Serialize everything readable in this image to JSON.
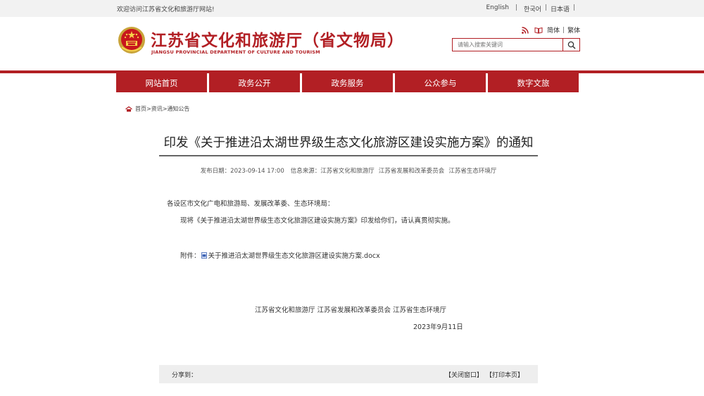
{
  "topbar": {
    "welcome": "欢迎访问江苏省文化和旅游厅网站!",
    "lang_english": "English",
    "lang_korean": "한국어",
    "lang_japanese": "日本语"
  },
  "header": {
    "title": "江苏省文化和旅游厅（省文物局）",
    "subtitle": "JIANGSU PROVINCIAL DEPARTMENT OF CULTURE AND TOURISM",
    "simplified": "简体",
    "traditional": "繁体",
    "search_placeholder": "请输入搜索关键词"
  },
  "nav": {
    "items": [
      "网站首页",
      "政务公开",
      "政务服务",
      "公众参与",
      "数字文旅"
    ]
  },
  "breadcrumb": {
    "home": "首页",
    "sep1": ">",
    "section": "资讯",
    "sep2": ">",
    "current": "通知公告"
  },
  "article": {
    "title": "印发《关于推进沿太湖世界级生态文化旅游区建设实施方案》的通知",
    "date_label": "发布日期：2023-09-14  17:00",
    "source_label": "信息来源：",
    "source_1": "江苏省文化和旅游厅",
    "source_2": "江苏省发展和改革委员会",
    "source_3": "江苏省生态环境厅",
    "salutation": "各设区市文化广电和旅游局、发展改革委、生态环境局：",
    "body": "现将《关于推进沿太湖世界级生态文化旅游区建设实施方案》印发给你们，请认真贯彻实施。",
    "attachment_label": "附件：",
    "attachment_name": "关于推进沿太湖世界级生态文化旅游区建设实施方案.docx",
    "signature": "江苏省文化和旅游厅   江苏省发展和改革委员会   江苏省生态环境厅",
    "sign_date": "2023年9月11日"
  },
  "footerbar": {
    "share": "分享到：",
    "close": "【关闭窗口】",
    "print": "【打印本页】"
  },
  "colors": {
    "brand_red": "#b21f24",
    "topbar_bg": "#f2f2f2",
    "sharebar_bg": "#eeeeee"
  }
}
